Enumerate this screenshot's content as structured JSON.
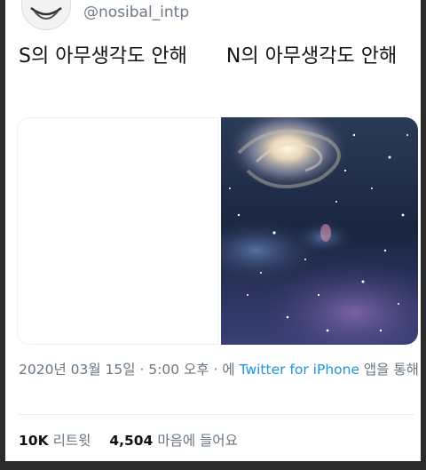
{
  "tweet": {
    "handle": "@nosibal_intp",
    "text_s": "S의 아무생각도 안해",
    "text_n": "N의 아무생각도 안해",
    "timestamp": "2020년 03월 15일 · 5:00 오후 · 에",
    "source": "Twitter for iPhone",
    "source_suffix": "앱을 통해",
    "retweets_count": "10K",
    "retweets_label": "리트윗",
    "likes_count": "4,504",
    "likes_label": "마음에 들어요"
  },
  "images": {
    "left": "blank-white-image",
    "right": "galaxy-space-image"
  },
  "colors": {
    "link": "#1b95e0",
    "meta": "#687683",
    "handle": "#6e7b87"
  }
}
